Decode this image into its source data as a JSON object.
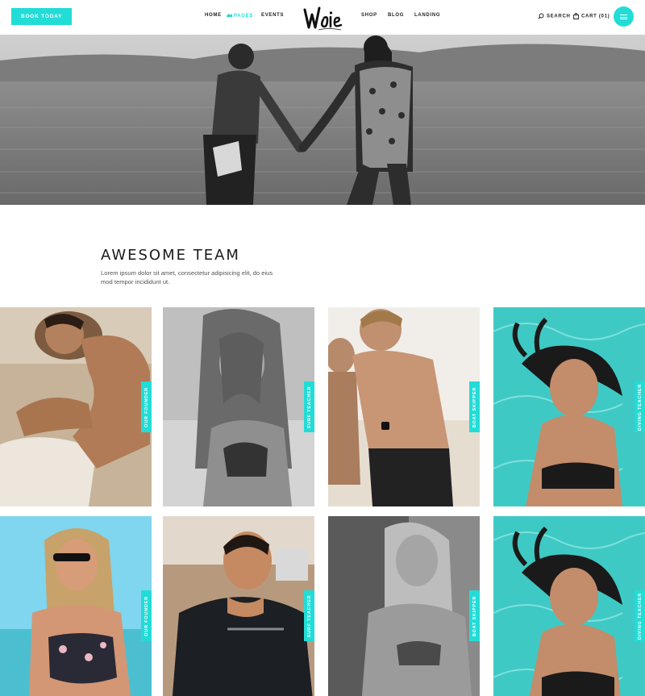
{
  "header": {
    "book_button": "Book Today",
    "nav": [
      {
        "label": "Home"
      },
      {
        "label": "Pages"
      },
      {
        "label": "Events"
      },
      {
        "label": "Shop"
      },
      {
        "label": "Blog"
      },
      {
        "label": "Landing"
      }
    ],
    "search_label": "Search",
    "cart_label": "Cart (01)",
    "logo_alt": "Waie"
  },
  "section": {
    "title": "Awesome Team",
    "subtitle": "Lorem ipsum dolor sit amet, consectetur adipisicing elit, do eius mod tempor incididunt ut."
  },
  "team": [
    {
      "role": "Our Founder"
    },
    {
      "role": "Surf Teacher"
    },
    {
      "role": "Boat Skipper"
    },
    {
      "role": "Diving Teacher"
    },
    {
      "role": "Our Founder"
    },
    {
      "role": "Surf Teacher"
    },
    {
      "role": "Boat Skipper"
    },
    {
      "role": "Diving Teacher"
    }
  ],
  "colors": {
    "accent": "#22dcd6"
  }
}
